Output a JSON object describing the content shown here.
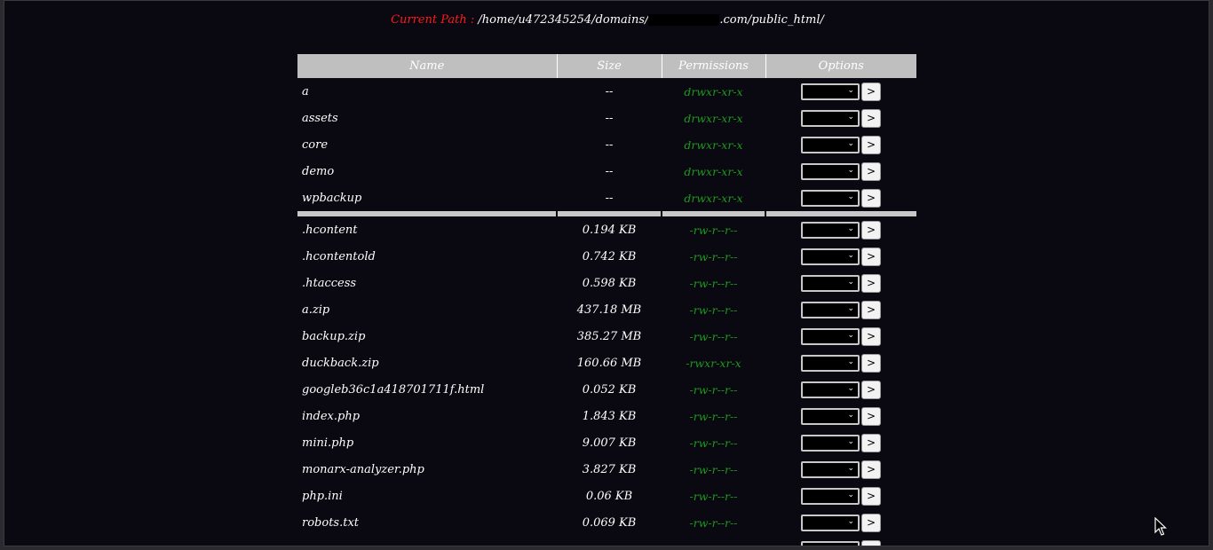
{
  "header": {
    "path_label": "Current Path :",
    "path_prefix": "/home/u472345254/domains/",
    "path_suffix": ".com/public_html/"
  },
  "table": {
    "columns": [
      "Name",
      "Size",
      "Permissions",
      "Options"
    ],
    "option_button": ">",
    "directories": [
      {
        "name": "a",
        "size": "--",
        "perm": "drwxr-xr-x"
      },
      {
        "name": "assets",
        "size": "--",
        "perm": "drwxr-xr-x"
      },
      {
        "name": "core",
        "size": "--",
        "perm": "drwxr-xr-x"
      },
      {
        "name": "demo",
        "size": "--",
        "perm": "drwxr-xr-x"
      },
      {
        "name": "wpbackup",
        "size": "--",
        "perm": "drwxr-xr-x"
      }
    ],
    "files": [
      {
        "name": ".hcontent",
        "size": "0.194 KB",
        "perm": "-rw-r--r--"
      },
      {
        "name": ".hcontentold",
        "size": "0.742 KB",
        "perm": "-rw-r--r--"
      },
      {
        "name": ".htaccess",
        "size": "0.598 KB",
        "perm": "-rw-r--r--"
      },
      {
        "name": "a.zip",
        "size": "437.18 MB",
        "perm": "-rw-r--r--"
      },
      {
        "name": "backup.zip",
        "size": "385.27 MB",
        "perm": "-rw-r--r--"
      },
      {
        "name": "duckback.zip",
        "size": "160.66 MB",
        "perm": "-rwxr-xr-x"
      },
      {
        "name": "googleb36c1a418701711f.html",
        "size": "0.052 KB",
        "perm": "-rw-r--r--"
      },
      {
        "name": "index.php",
        "size": "1.843 KB",
        "perm": "-rw-r--r--"
      },
      {
        "name": "mini.php",
        "size": "9.007 KB",
        "perm": "-rw-r--r--"
      },
      {
        "name": "monarx-analyzer.php",
        "size": "3.827 KB",
        "perm": "-rw-r--r--"
      },
      {
        "name": "php.ini",
        "size": "0.06 KB",
        "perm": "-rw-r--r--"
      },
      {
        "name": "robots.txt",
        "size": "0.069 KB",
        "perm": "-rw-r--r--"
      },
      {
        "name": "",
        "size": "",
        "perm": ""
      }
    ]
  }
}
